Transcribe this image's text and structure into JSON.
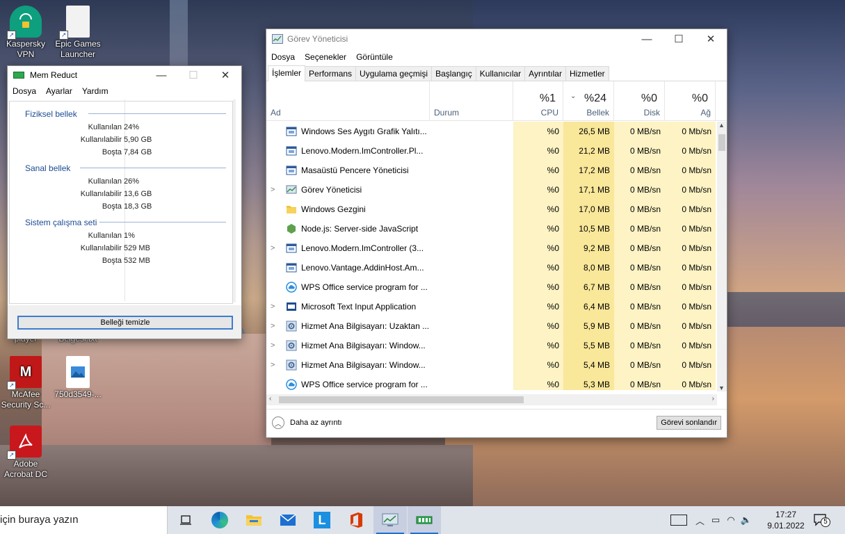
{
  "desktop": {
    "icons": [
      {
        "label_line1": "Kaspersky",
        "label_line2": "VPN",
        "color": "#0e9f7e"
      },
      {
        "label_line1": "Epic Games",
        "label_line2": "Launcher",
        "color": "#f2f2f2"
      },
      {
        "label_line1": "McAfee",
        "label_line2": "Security Sc...",
        "color": "#c01818"
      },
      {
        "label_line1": "750d3549-...",
        "label_line2": "",
        "color": "#ffffff"
      },
      {
        "label_line1": "Adobe",
        "label_line2": "Acrobat DC",
        "color": "#c8181d"
      }
    ],
    "partial_labels": [
      "player",
      "Belgesi.txt"
    ]
  },
  "memreduct": {
    "title": "Mem Reduct",
    "menu": [
      "Dosya",
      "Ayarlar",
      "Yardım"
    ],
    "groups": [
      {
        "name": "Fiziksel bellek",
        "rows": [
          {
            "key": "Kullanılan",
            "value": "24%"
          },
          {
            "key": "Kullanılabilir",
            "value": "5,90 GB"
          },
          {
            "key": "Boşta",
            "value": "7,84 GB"
          }
        ]
      },
      {
        "name": "Sanal bellek",
        "rows": [
          {
            "key": "Kullanılan",
            "value": "26%"
          },
          {
            "key": "Kullanılabilir",
            "value": "13,6 GB"
          },
          {
            "key": "Boşta",
            "value": "18,3 GB"
          }
        ]
      },
      {
        "name": "Sistem çalışma seti",
        "rows": [
          {
            "key": "Kullanılan",
            "value": "1%"
          },
          {
            "key": "Kullanılabilir",
            "value": "529 MB"
          },
          {
            "key": "Boşta",
            "value": "532 MB"
          }
        ]
      }
    ],
    "button": "Belleği temizle"
  },
  "taskmgr": {
    "title": "Görev Yöneticisi",
    "menu": [
      "Dosya",
      "Seçenekler",
      "Görüntüle"
    ],
    "tabs": [
      "İşlemler",
      "Performans",
      "Uygulama geçmişi",
      "Başlangıç",
      "Kullanıcılar",
      "Ayrıntılar",
      "Hizmetler"
    ],
    "columns": {
      "name": "Ad",
      "status": "Durum",
      "cpu": {
        "pct": "%1",
        "label": "CPU"
      },
      "mem": {
        "pct": "%24",
        "label": "Bellek"
      },
      "disk": {
        "pct": "%0",
        "label": "Disk"
      },
      "net": {
        "pct": "%0",
        "label": "Ağ"
      }
    },
    "processes": [
      {
        "name": "Windows Ses Aygıtı Grafik Yalıtı...",
        "expand": false,
        "icon": "window-icon",
        "cpu": "%0",
        "mem": "26,5 MB",
        "disk": "0 MB/sn",
        "net": "0 Mb/sn"
      },
      {
        "name": "Lenovo.Modern.ImController.Pl...",
        "expand": false,
        "icon": "window-icon",
        "cpu": "%0",
        "mem": "21,2 MB",
        "disk": "0 MB/sn",
        "net": "0 Mb/sn"
      },
      {
        "name": "Masaüstü Pencere Yöneticisi",
        "expand": false,
        "icon": "window-icon",
        "cpu": "%0",
        "mem": "17,2 MB",
        "disk": "0 MB/sn",
        "net": "0 Mb/sn"
      },
      {
        "name": "Görev Yöneticisi",
        "expand": true,
        "icon": "taskmgr-icon",
        "cpu": "%0",
        "mem": "17,1 MB",
        "disk": "0 MB/sn",
        "net": "0 Mb/sn"
      },
      {
        "name": "Windows Gezgini",
        "expand": false,
        "icon": "folder-icon",
        "cpu": "%0",
        "mem": "17,0 MB",
        "disk": "0 MB/sn",
        "net": "0 Mb/sn"
      },
      {
        "name": "Node.js: Server-side JavaScript",
        "expand": false,
        "icon": "nodejs-icon",
        "cpu": "%0",
        "mem": "10,5 MB",
        "disk": "0 MB/sn",
        "net": "0 Mb/sn"
      },
      {
        "name": "Lenovo.Modern.ImController (3...",
        "expand": true,
        "icon": "window-icon",
        "cpu": "%0",
        "mem": "9,2 MB",
        "disk": "0 MB/sn",
        "net": "0 Mb/sn"
      },
      {
        "name": "Lenovo.Vantage.AddinHost.Am...",
        "expand": false,
        "icon": "window-icon",
        "cpu": "%0",
        "mem": "8,0 MB",
        "disk": "0 MB/sn",
        "net": "0 Mb/sn"
      },
      {
        "name": "WPS Office service program for ...",
        "expand": false,
        "icon": "cloud-icon",
        "cpu": "%0",
        "mem": "6,7 MB",
        "disk": "0 MB/sn",
        "net": "0 Mb/sn"
      },
      {
        "name": "Microsoft Text Input Application",
        "expand": true,
        "icon": "keyboard-icon",
        "cpu": "%0",
        "mem": "6,4 MB",
        "disk": "0 MB/sn",
        "net": "0 Mb/sn"
      },
      {
        "name": "Hizmet Ana Bilgisayarı: Uzaktan ...",
        "expand": true,
        "icon": "gear-icon",
        "cpu": "%0",
        "mem": "5,9 MB",
        "disk": "0 MB/sn",
        "net": "0 Mb/sn"
      },
      {
        "name": "Hizmet Ana Bilgisayarı: Window...",
        "expand": true,
        "icon": "gear-icon",
        "cpu": "%0",
        "mem": "5,5 MB",
        "disk": "0 MB/sn",
        "net": "0 Mb/sn"
      },
      {
        "name": "Hizmet Ana Bilgisayarı: Window...",
        "expand": true,
        "icon": "gear-icon",
        "cpu": "%0",
        "mem": "5,4 MB",
        "disk": "0 MB/sn",
        "net": "0 Mb/sn"
      },
      {
        "name": "WPS Office service program for ...",
        "expand": false,
        "icon": "cloud-icon",
        "cpu": "%0",
        "mem": "5,3 MB",
        "disk": "0 MB/sn",
        "net": "0 Mb/sn"
      }
    ],
    "fewer_details": "Daha az ayrıntı",
    "end_task": "Görevi sonlandır"
  },
  "taskbar": {
    "search_placeholder": "için buraya yazın",
    "apps": [
      "task-view-icon",
      "edge-icon",
      "file-explorer-icon",
      "mail-icon",
      "lenovo-l-icon",
      "office-icon",
      "taskmgr-icon",
      "memreduct-icon"
    ],
    "time": "17:27",
    "date": "9.01.2022",
    "notification_count": "5"
  }
}
